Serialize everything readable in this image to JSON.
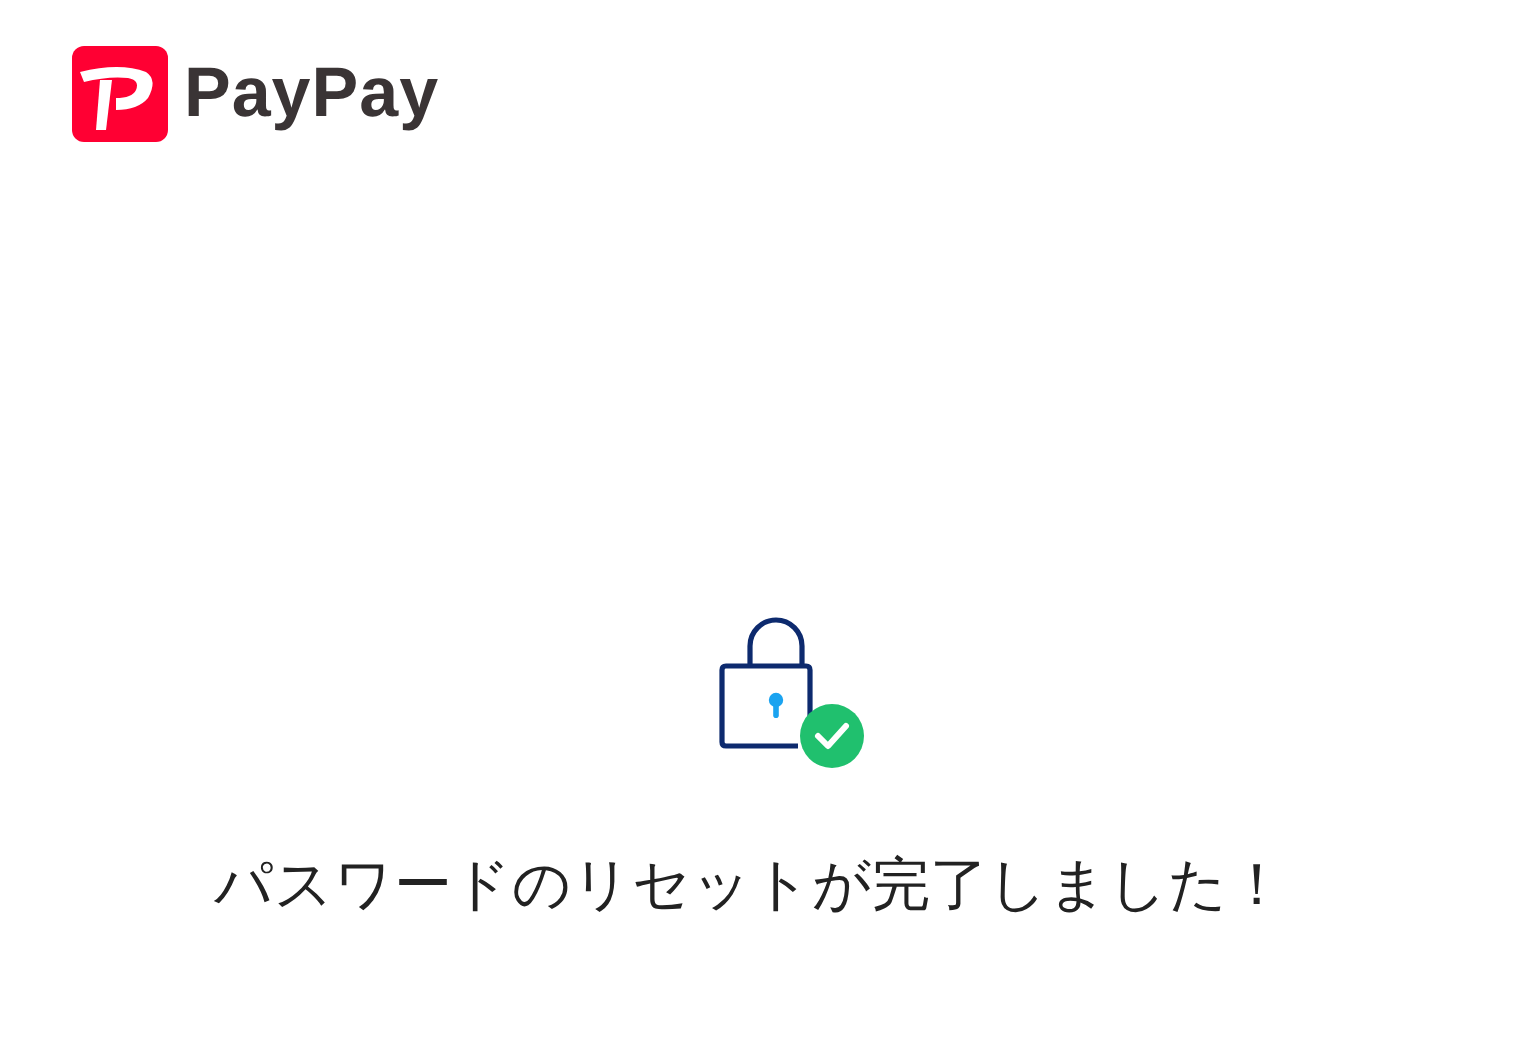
{
  "header": {
    "logo_text": "PayPay"
  },
  "message": "パスワードのリセットが完了しました！"
}
